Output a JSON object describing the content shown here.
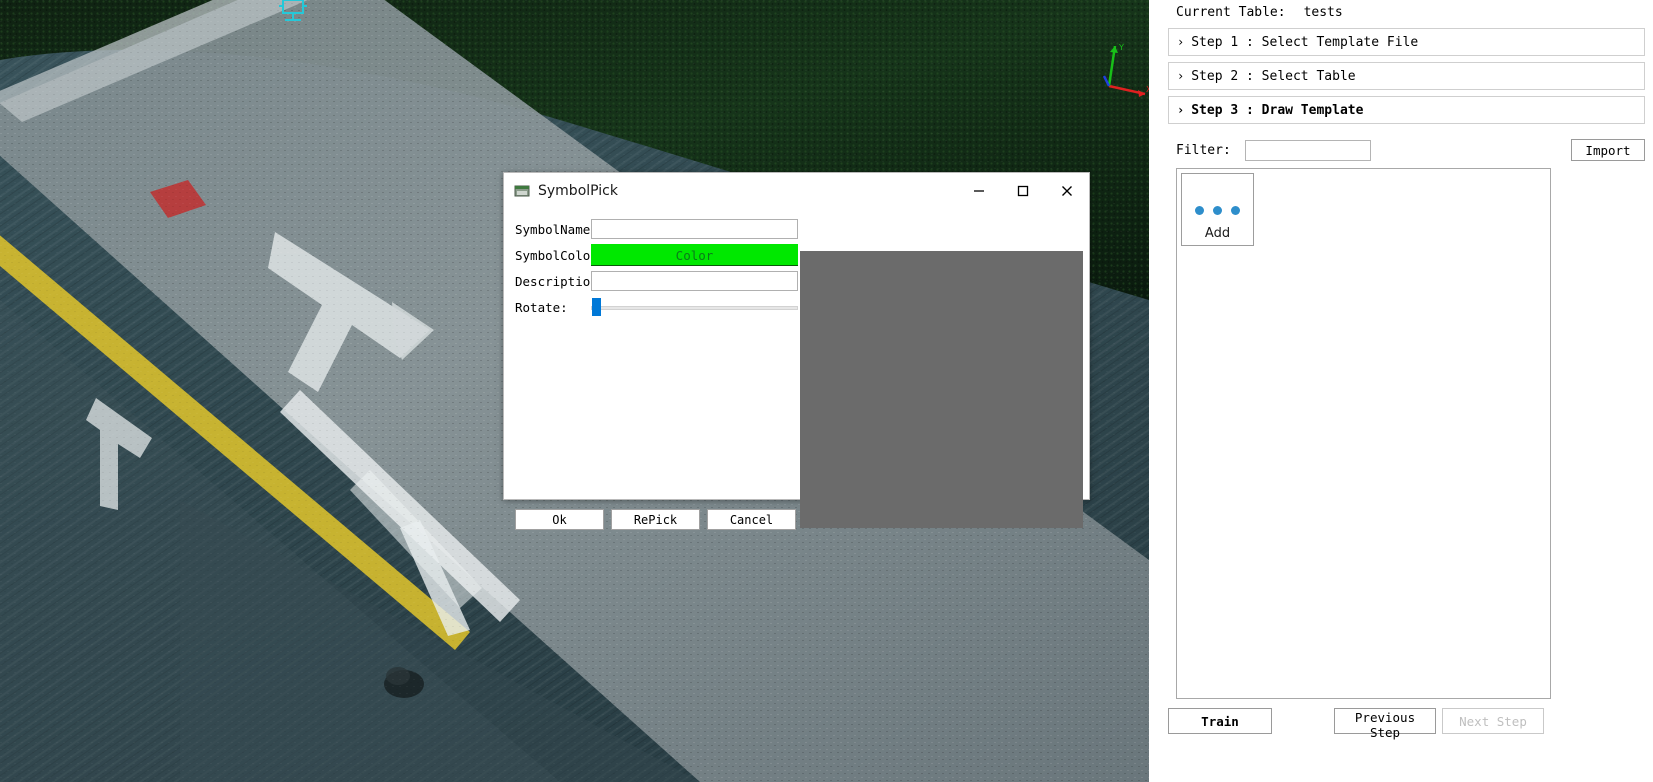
{
  "right_panel": {
    "current_table": {
      "label": "Current Table:",
      "value": "tests"
    },
    "steps": [
      {
        "chevron": "›",
        "label": "Step 1 : Select Template File",
        "active": false
      },
      {
        "chevron": "›",
        "label": "Step 2 : Select Table",
        "active": false
      },
      {
        "chevron": "›",
        "label": "Step 3 : Draw Template",
        "active": true
      }
    ],
    "filter": {
      "label": "Filter:",
      "value": "",
      "placeholder": ""
    },
    "import_button": "Import",
    "symbol_list": {
      "add_tile": {
        "label": "Add",
        "icon": "three-dots-icon",
        "dot_color": "#2e8ecb"
      }
    },
    "bottom_buttons": [
      {
        "label": "Train",
        "state": "enabled",
        "name": "train-button"
      },
      {
        "label": "Previous Step",
        "state": "enabled",
        "name": "previous-step-button"
      },
      {
        "label": "Next Step",
        "state": "disabled",
        "name": "next-step-button"
      }
    ]
  },
  "dialog": {
    "title": "SymbolPick",
    "icon": "app-window-icon",
    "window_controls": {
      "minimize": "—",
      "maximize": "☐",
      "close": "✕"
    },
    "fields": [
      {
        "label": "SymbolName:",
        "type": "text",
        "value": "",
        "placeholder": ""
      },
      {
        "label": "SymbolColor:",
        "type": "color",
        "value": "Color",
        "color": "#00e800"
      },
      {
        "label": "Description:",
        "type": "text",
        "value": "",
        "placeholder": ""
      },
      {
        "label": "Rotate:",
        "type": "slider",
        "value": 0
      }
    ],
    "preview": {
      "background": "#6b6b6b"
    },
    "buttons": [
      {
        "label": "Ok",
        "name": "ok-button"
      },
      {
        "label": "RePick",
        "name": "repick-button"
      },
      {
        "label": "Cancel",
        "name": "cancel-button"
      }
    ]
  },
  "viewport": {
    "gizmo": {
      "x_label": "X",
      "y_label": "Y",
      "x_color": "#e02020",
      "y_color": "#18c018",
      "z_color": "#2040e0"
    },
    "marker_color": "#25c8d8"
  }
}
